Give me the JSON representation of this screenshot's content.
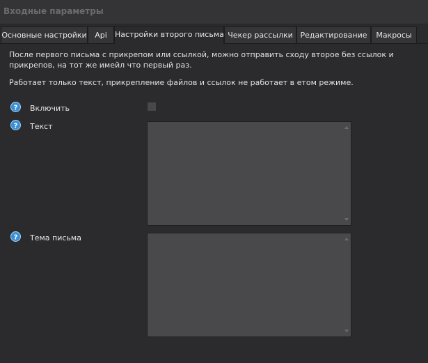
{
  "window": {
    "title": "Входные параметры"
  },
  "tabs": [
    {
      "label": "Основные настройки"
    },
    {
      "label": "Api"
    },
    {
      "label": "Настройки второго письма",
      "active": true
    },
    {
      "label": "Чекер рассылки"
    },
    {
      "label": "Редактирование"
    },
    {
      "label": "Макросы"
    }
  ],
  "panel": {
    "description_line1": "После первого письма с прикрепом или ссылкой, можно отправить сходу второе без ссылок и",
    "description_line2": "прикрепов, на тот же имейл что первый раз.",
    "note": "Работает только текст, прикрепление файлов и ссылок не работает в етом режиме.",
    "fields": [
      {
        "label": "Включить",
        "type": "checkbox",
        "checked": false
      },
      {
        "label": "Текст",
        "type": "textarea",
        "value": ""
      },
      {
        "label": "Тема письма",
        "type": "textarea",
        "value": ""
      }
    ]
  },
  "icons": {
    "help": "question-circle-icon",
    "scroll_up": "triangle-up-icon",
    "scroll_down": "triangle-down-icon"
  },
  "colors": {
    "help_icon_fill": "#3a8fd6",
    "background": "#2b2b2d",
    "field_background": "#49494c"
  }
}
